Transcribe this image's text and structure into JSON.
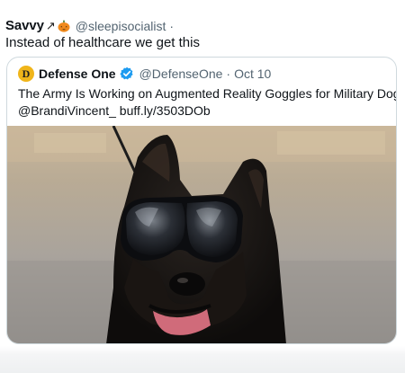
{
  "tweet": {
    "display_name": "Savvy",
    "name_emoji": "↗",
    "name_pumpkin_icon": "pumpkin-icon",
    "handle": "@sleepisocialist",
    "separator": "·",
    "text": "Instead of healthcare we get this"
  },
  "quoted_tweet": {
    "avatar_letter": "D",
    "avatar_color": "#f0b51a",
    "display_name": "Defense One",
    "verified_icon": "verified-badge-icon",
    "verified_color": "#1d9bf0",
    "handle": "@DefenseOne",
    "separator": "·",
    "date": "Oct 10",
    "text_line_1": "The Army Is Working on Augmented Reality Goggles for Military Dogs |",
    "text_line_2": "@BrandiVincent_ buff.ly/3503DOb",
    "media": {
      "subject": "German shepherd wearing reflective goggles"
    }
  },
  "colors": {
    "text_primary": "#0f1419",
    "text_secondary": "#536471",
    "border": "#cfd9de"
  }
}
